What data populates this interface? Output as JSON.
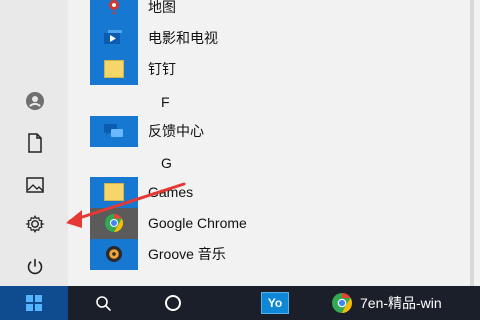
{
  "app_list": [
    {
      "label": "地图",
      "icon": "map-icon",
      "tile": "blue"
    },
    {
      "label": "电影和电视",
      "icon": "movies-tv-icon",
      "tile": "blue"
    },
    {
      "label": "钉钉",
      "icon": "folder-icon",
      "tile": "blue",
      "expandable": true
    },
    {
      "section": "F"
    },
    {
      "label": "反馈中心",
      "icon": "feedback-hub-icon",
      "tile": "blue"
    },
    {
      "section": "G"
    },
    {
      "label": "Games",
      "icon": "folder-icon",
      "tile": "blue",
      "expandable": true
    },
    {
      "label": "Google Chrome",
      "icon": "chrome-icon",
      "tile": "mid"
    },
    {
      "label": "Groove 音乐",
      "icon": "groove-music-icon",
      "tile": "blue"
    }
  ],
  "sections": {
    "f": "F",
    "g": "G"
  },
  "labels": {
    "maps": "地图",
    "movies": "电影和电视",
    "dingtalk": "钉钉",
    "feedback": "反馈中心",
    "games": "Games",
    "chrome": "Google Chrome",
    "groove": "Groove 音乐"
  },
  "left_rail": [
    "user-icon",
    "documents-icon",
    "pictures-icon",
    "settings-icon",
    "power-icon"
  ],
  "annotation": {
    "color": "#e53935",
    "points_to": "settings-icon"
  },
  "taskbar": {
    "browser_label": "7en-精品-win",
    "yo_label": "Yo"
  },
  "colors": {
    "tile_blue": "#1778d2",
    "taskbar_bg": "#1a1f29",
    "start_button_bg": "#0f4c8f",
    "menu_bg": "#f2f2f2"
  }
}
